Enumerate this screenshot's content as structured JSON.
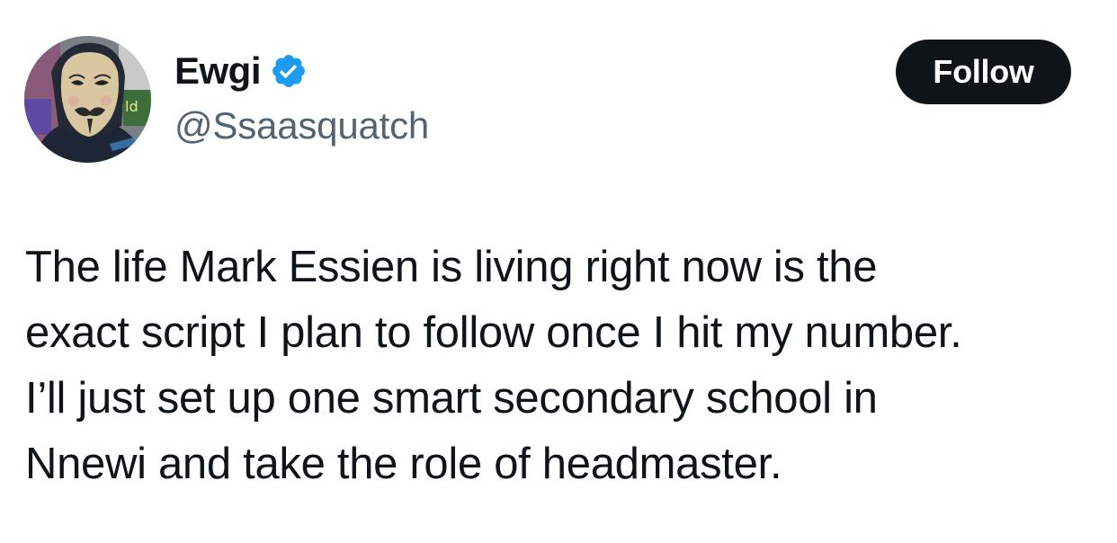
{
  "author": {
    "display_name": "Ewgi",
    "handle": "@Ssaasquatch",
    "verified": true,
    "verified_color": "#1d9bf0"
  },
  "follow_button": {
    "label": "Follow",
    "background": "#0f1419",
    "text_color": "#ffffff"
  },
  "tweet": {
    "lines": [
      "The life Mark Essien is living right now is the",
      "exact script I plan to follow once I hit my number.",
      "I’ll just set up one smart secondary school in",
      "Nnewi and take the role of headmaster."
    ]
  },
  "icons": {
    "verified": "verified-badge-icon",
    "avatar": "guy-fawkes-mask-avatar"
  },
  "colors": {
    "text": "#0f1419",
    "secondary_text": "#536471",
    "background": "#ffffff"
  }
}
